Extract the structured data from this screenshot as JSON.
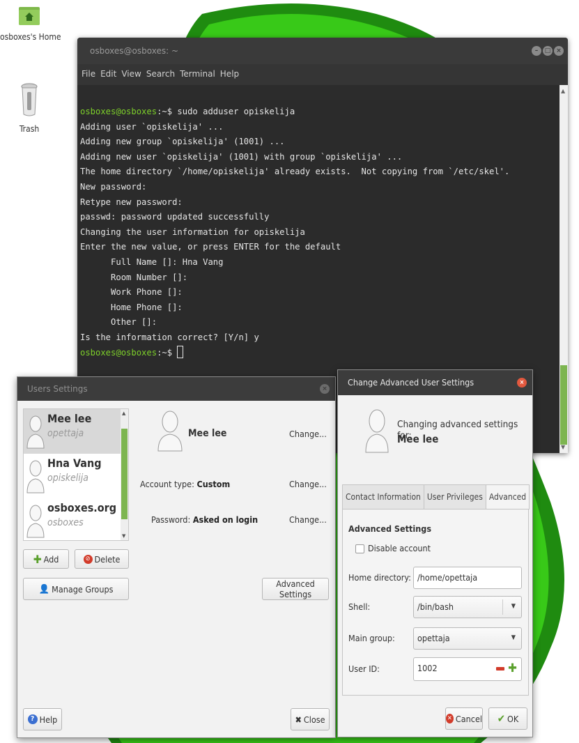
{
  "desktop": {
    "icons": [
      {
        "label": "osboxes's Home",
        "icon": "home-folder-icon"
      },
      {
        "label": "Trash",
        "icon": "trash-icon"
      }
    ]
  },
  "terminal": {
    "title": "osboxes@osboxes: ~",
    "menu": [
      "File",
      "Edit",
      "View",
      "Search",
      "Terminal",
      "Help"
    ],
    "prompt": "osboxes@osboxes",
    "prompt_suffix": ":~$",
    "command": " sudo adduser opiskelija",
    "output": [
      "Adding user `opiskelija' ...",
      "Adding new group `opiskelija' (1001) ...",
      "Adding new user `opiskelija' (1001) with group `opiskelija' ...",
      "The home directory `/home/opiskelija' already exists.  Not copying from `/etc/skel'.",
      "New password:",
      "Retype new password:",
      "passwd: password updated successfully",
      "Changing the user information for opiskelija",
      "Enter the new value, or press ENTER for the default",
      "\tFull Name []: Hna Vang",
      "\tRoom Number []:",
      "\tWork Phone []:",
      "\tHome Phone []:",
      "\tOther []:",
      "Is the information correct? [Y/n] y"
    ],
    "final_prompt_suffix": ":~$ ",
    "colors": {
      "background": "#2b2b2b",
      "prompt": "#7ed12a",
      "text": "#e6e6e6"
    }
  },
  "users_settings": {
    "title": "Users Settings",
    "users": [
      {
        "name": "Mee lee",
        "login": "opettaja",
        "selected": true
      },
      {
        "name": "Hna Vang",
        "login": "opiskelija",
        "selected": false
      },
      {
        "name": "osboxes.org",
        "login": "osboxes",
        "selected": false
      }
    ],
    "add_label": "Add",
    "delete_label": "Delete",
    "manage_groups_label": "Manage Groups",
    "selected_name": "Mee lee",
    "change_label": "Change...",
    "account_type_label": "Account type:",
    "account_type_value": "Custom",
    "password_label": "Password:",
    "password_value": "Asked on login",
    "advanced_settings_label": "Advanced Settings",
    "help_label": "Help",
    "close_label": "Close"
  },
  "advanced_dialog": {
    "title": "Change Advanced User Settings",
    "heading": "Changing advanced settings for:",
    "user_name": "Mee lee",
    "tabs": [
      "Contact Information",
      "User Privileges",
      "Advanced"
    ],
    "active_tab": "Advanced",
    "section_title": "Advanced Settings",
    "disable_account_label": "Disable account",
    "disable_account_checked": false,
    "home_directory_label": "Home directory:",
    "home_directory_value": "/home/opettaja",
    "shell_label": "Shell:",
    "shell_value": "/bin/bash",
    "main_group_label": "Main group:",
    "main_group_value": "opettaja",
    "user_id_label": "User ID:",
    "user_id_value": "1002",
    "cancel_label": "Cancel",
    "ok_label": "OK"
  }
}
